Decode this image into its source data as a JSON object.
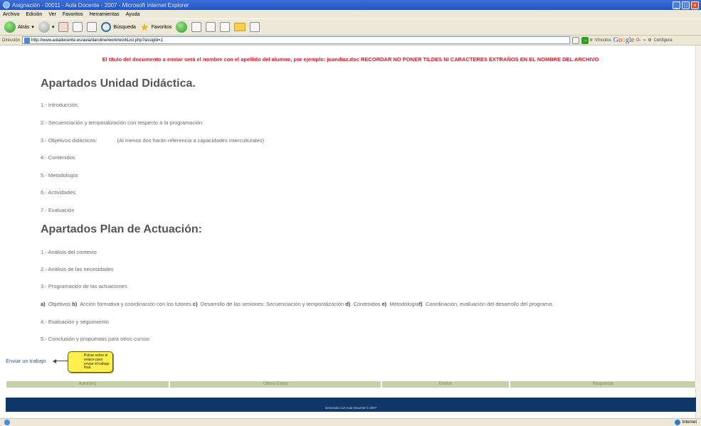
{
  "window": {
    "title": "Asignación - 00011 - Aula Docente - 2007 - Microsoft Internet Explorer"
  },
  "menu": [
    "Archivo",
    "Edición",
    "Ver",
    "Favoritos",
    "Herramientas",
    "Ayuda"
  ],
  "toolbar": {
    "back_label": "Atrás",
    "search_label": "Búsqueda",
    "favorites_label": "Favoritos"
  },
  "address": {
    "label": "Dirección",
    "url": "http://www.auladocente.es/aula/daroline/work/workList.php?assigId=1",
    "go_label": "Ir",
    "links_label": "Vínculos",
    "google_suffix": "G-",
    "config_label": "Configura"
  },
  "notice": "El título del documento a enviar será el nombre con el apellido del alumno, por ejemplo: juandiaz.doc RECORDAR NO PONER TILDES NI CARACTERES EXTRAÑOS EN EL NOMBRE DEL ARCHIVO",
  "unidad": {
    "title": "Apartados Unidad Didáctica.",
    "items": [
      "1.- Introducción.",
      "2.- Secuenciación y temporalización con respecto a la programación",
      "3.- Objetivos didácticos:",
      "4.- Contenidos",
      "5.- Metodología",
      "6.- Actividades.",
      "7.- Evaluación"
    ],
    "item3_note": "(Al menos dos harán referencia a capacidades interculturales)"
  },
  "plan": {
    "title": "Apartados Plan de Actuación:",
    "items": [
      "1.- Análisis del contexto",
      "2.- Análisis de las necesidades",
      "3.- Programación de las actuaciones"
    ],
    "subitems": {
      "a_key": "a)",
      "a_text": "Objetivos",
      "b_key": "b)",
      "b_text": "Acción formativa y coordinación con los tutores",
      "c_key": "c)",
      "c_text": "Desarrollo de las sesiones: Secuenciación y temporalización",
      "d_key": "d)",
      "d_text": "Contenidos",
      "e_key": "e)",
      "e_text": "Metodología",
      "f_key": "f)",
      "f_text": "Coordinación, evaluación del desarrollo del programa."
    },
    "items_after": [
      "4.- Evaluación y seguimiento",
      "5.- Conclusión y propuestas para otros cursos"
    ]
  },
  "enviar_link": "Enviar un trabajo",
  "tooltip": "Pulsar sobre el enlace para enviar el trabajo final.",
  "table": {
    "headers": [
      "Autor(es)",
      "Último Envío",
      "Envíos",
      "Respuesta"
    ]
  },
  "footer": "Generado con Aula Docente © 2007",
  "status": {
    "zone": "Internet"
  }
}
